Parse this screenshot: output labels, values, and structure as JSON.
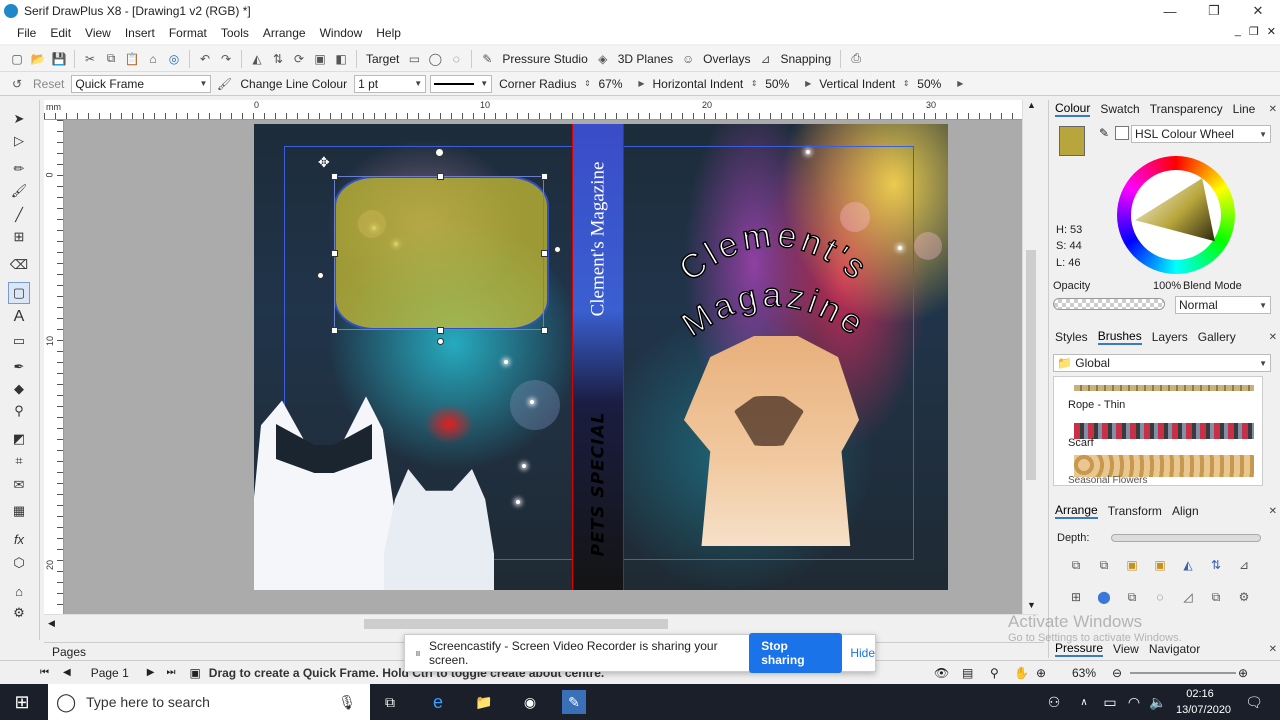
{
  "window": {
    "title": "Serif DrawPlus X8 - [Drawing1 v2 (RGB) *]",
    "min": "—",
    "max": "❐",
    "close": "✕"
  },
  "menu": [
    "File",
    "Edit",
    "View",
    "Insert",
    "Format",
    "Tools",
    "Arrange",
    "Window",
    "Help"
  ],
  "toolbar1": {
    "target": "Target",
    "pressure_studio": "Pressure Studio",
    "planes_3d": "3D Planes",
    "overlays": "Overlays",
    "snapping": "Snapping"
  },
  "toolbar2": {
    "reset": "Reset",
    "shape": "Quick Frame",
    "change_line_colour": "Change Line Colour",
    "line_width": "1 pt",
    "corner_radius_label": "Corner Radius",
    "corner_radius": "67%",
    "h_indent_label": "Horizontal Indent",
    "h_indent": "50%",
    "v_indent_label": "Vertical Indent",
    "v_indent": "50%"
  },
  "ruler": {
    "unit": "mm",
    "h_labels": [
      "0",
      "10",
      "20",
      "30"
    ],
    "v_labels": [
      "0",
      "10",
      "20"
    ]
  },
  "cover": {
    "spine_title": "Clement's Magazine",
    "spine_subtitle": "PETS SPECIAL",
    "front_title_top": "Clement's",
    "front_title_bottom": "Magazine"
  },
  "colour_panel": {
    "tabs": [
      "Colour",
      "Swatch",
      "Transparency",
      "Line"
    ],
    "mode": "HSL Colour Wheel",
    "h": "H: 53",
    "s": "S: 44",
    "l": "L: 46",
    "opacity_label": "Opacity",
    "opacity_value": "100%",
    "blend_label": "Blend Mode",
    "blend_value": "Normal",
    "current_colour": "#b8a63c"
  },
  "brushes_panel": {
    "tabs": [
      "Styles",
      "Brushes",
      "Layers",
      "Gallery"
    ],
    "category": "Global",
    "items": [
      "Rope - Thin",
      "Scarf",
      "Seasonal Flowers"
    ]
  },
  "arrange_panel": {
    "tabs": [
      "Arrange",
      "Transform",
      "Align"
    ],
    "depth_label": "Depth:"
  },
  "bottom_tabs": [
    "Pressure",
    "View",
    "Navigator"
  ],
  "pages": {
    "label": "Pages",
    "current": "Page 1"
  },
  "status": {
    "hint": "Drag to create a Quick Frame. Hold Ctrl to toggle create about centre.",
    "zoom": "63%"
  },
  "screencastify": {
    "message": "Screencastify - Screen Video Recorder is sharing your screen.",
    "stop": "Stop sharing",
    "hide": "Hide"
  },
  "watermark": {
    "line1": "Activate Windows",
    "line2": "Go to Settings to activate Windows."
  },
  "taskbar": {
    "search_placeholder": "Type here to search",
    "time": "02:16",
    "date": "13/07/2020"
  }
}
